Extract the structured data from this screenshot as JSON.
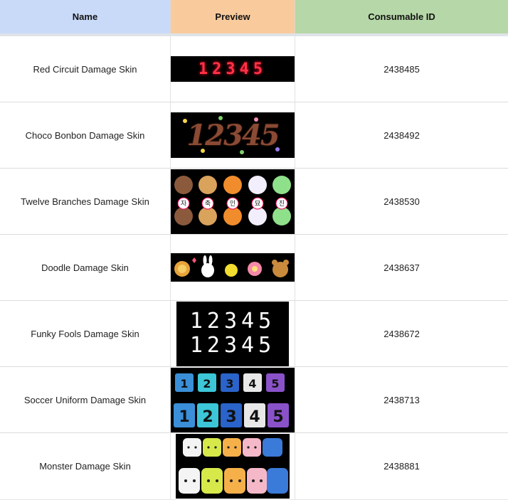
{
  "header": {
    "name": "Name",
    "preview": "Preview",
    "id": "Consumable ID"
  },
  "rows": [
    {
      "name": "Red Circuit Damage Skin",
      "id": "2438485",
      "preview_digits": "12345"
    },
    {
      "name": "Choco Bonbon Damage Skin",
      "id": "2438492",
      "preview_digits": "12345"
    },
    {
      "name": "Twelve Branches Damage Skin",
      "id": "2438530",
      "preview_glyphs": [
        "자",
        "축",
        "인",
        "묘",
        "진"
      ]
    },
    {
      "name": "Doodle Damage Skin",
      "id": "2438637"
    },
    {
      "name": "Funky Fools Damage Skin",
      "id": "2438672",
      "preview_digits": "12345"
    },
    {
      "name": "Soccer Uniform Damage Skin",
      "id": "2438713",
      "preview_digits": [
        "1",
        "2",
        "3",
        "4",
        "5"
      ]
    },
    {
      "name": "Monster Damage Skin",
      "id": "2438881"
    }
  ],
  "colors": {
    "header_name_bg": "#c9daf8",
    "header_preview_bg": "#f9cb9c",
    "header_id_bg": "#b6d7a8",
    "preview_bg": "#000000"
  }
}
